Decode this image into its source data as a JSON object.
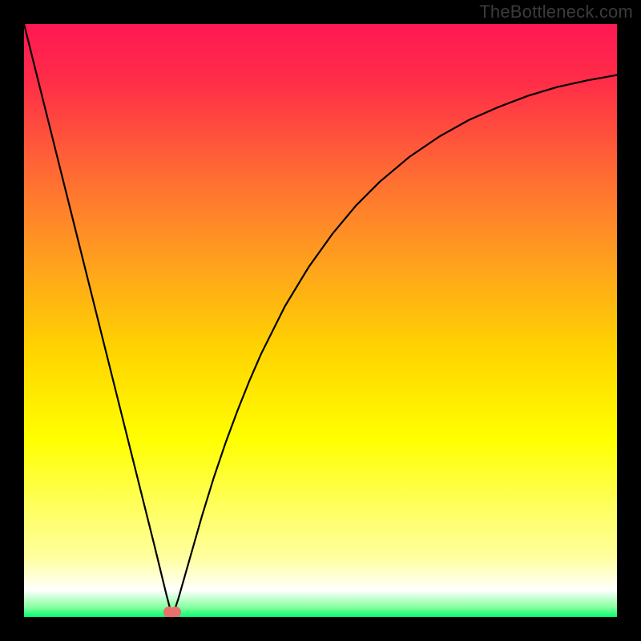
{
  "watermark": "TheBottleneck.com",
  "chart_data": {
    "type": "line",
    "title": "",
    "xlabel": "",
    "ylabel": "",
    "xlim": [
      0,
      100
    ],
    "ylim": [
      0,
      100
    ],
    "legend": false,
    "grid": false,
    "background_gradient": {
      "stops": [
        {
          "pos": 0.0,
          "color": "#ff1854"
        },
        {
          "pos": 0.1,
          "color": "#ff2e47"
        },
        {
          "pos": 0.25,
          "color": "#ff6a34"
        },
        {
          "pos": 0.4,
          "color": "#ffa01e"
        },
        {
          "pos": 0.55,
          "color": "#ffd400"
        },
        {
          "pos": 0.7,
          "color": "#ffff00"
        },
        {
          "pos": 0.82,
          "color": "#ffff63"
        },
        {
          "pos": 0.9,
          "color": "#ffff9f"
        },
        {
          "pos": 0.955,
          "color": "#ffffff"
        },
        {
          "pos": 0.985,
          "color": "#7fff9a"
        },
        {
          "pos": 1.0,
          "color": "#00ff72"
        }
      ]
    },
    "x": [
      0,
      2,
      4,
      6,
      8,
      10,
      12,
      14,
      16,
      18,
      20,
      22,
      24,
      25,
      26,
      27,
      28,
      30,
      32,
      34,
      36,
      38,
      40,
      44,
      48,
      52,
      56,
      60,
      65,
      70,
      75,
      80,
      85,
      90,
      95,
      100
    ],
    "values": [
      100.0,
      92.0,
      84.0,
      76.0,
      68.0,
      60.0,
      52.0,
      44.0,
      36.0,
      28.0,
      20.0,
      12.0,
      3.8,
      0.0,
      3.0,
      6.5,
      10.0,
      17.0,
      23.5,
      29.4,
      34.8,
      39.8,
      44.4,
      52.4,
      59.0,
      64.6,
      69.4,
      73.4,
      77.6,
      81.0,
      83.8,
      86.0,
      87.9,
      89.4,
      90.5,
      91.4
    ],
    "marker": {
      "x": 25,
      "y": 0,
      "shape": "double-dot",
      "color": "#e8716b"
    }
  }
}
